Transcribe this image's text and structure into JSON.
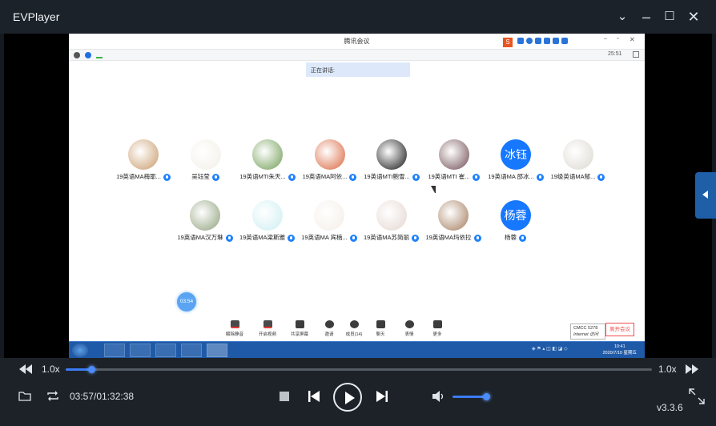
{
  "window": {
    "title": "EVPlayer"
  },
  "meeting": {
    "title": "腾讯会议",
    "elapsed": "25:51",
    "talking_label": "正在讲话:",
    "participants_row1": [
      {
        "name": "19英语MA梅耶...",
        "avatar_color": "#c89a6a"
      },
      {
        "name": "吴钰莹",
        "avatar_color": "#f3efe6"
      },
      {
        "name": "19英语MTI朱天...",
        "avatar_color": "#6f9c52"
      },
      {
        "name": "19英语MA阿依...",
        "avatar_color": "#d9643c"
      },
      {
        "name": "19英语MTI鲍雪...",
        "avatar_color": "#111111"
      },
      {
        "name": "19英语MTI 崔...",
        "avatar_color": "#6e4b52"
      },
      {
        "name": "19英语MA 邵冰...",
        "avatar_text": "冰钰",
        "avatar_color": "#1677ff"
      },
      {
        "name": "19级英语MA郁...",
        "avatar_color": "#ddd8cf"
      }
    ],
    "participants_row2": [
      {
        "name": "19英语MA汉万琳",
        "avatar_color": "#8ea07a"
      },
      {
        "name": "19英语MA梁斯雅",
        "avatar_color": "#cdeef2"
      },
      {
        "name": "19英语MA 宾楠...",
        "avatar_color": "#f4ede6"
      },
      {
        "name": "19英语MA苏简丽",
        "avatar_color": "#e4d6d0"
      },
      {
        "name": "19英语MA玛依拉",
        "avatar_color": "#a27a5a"
      },
      {
        "name": "杨蓉",
        "avatar_text": "杨蓉",
        "avatar_color": "#1677ff"
      }
    ],
    "timer": "03:54",
    "toolbar": [
      {
        "label": "解除静音",
        "icon": "microphone-icon"
      },
      {
        "label": "开启视频",
        "icon": "camera-icon"
      },
      {
        "label": "共享屏幕",
        "icon": "share-screen-icon"
      },
      {
        "label": "邀请",
        "icon": "invite-icon"
      },
      {
        "label": "成员(14)",
        "icon": "members-icon"
      },
      {
        "label": "聊天",
        "icon": "chat-icon"
      },
      {
        "label": "表情",
        "icon": "emoji-icon"
      },
      {
        "label": "更多",
        "icon": "more-icon"
      }
    ],
    "network_label_1": "CMCC 5278",
    "network_label_2": "Internet 访问",
    "leave_label": "离开会议",
    "taskbar_time": "10:41",
    "taskbar_date": "2020/7/10 星期五"
  },
  "player": {
    "speed_left": "1.0x",
    "speed_right": "1.0x",
    "progress": 0.0431,
    "time_display": "03:57/01:32:38",
    "volume": 1.0,
    "version": "v3.3.6"
  }
}
